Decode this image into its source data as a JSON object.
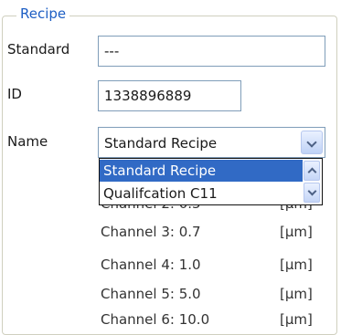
{
  "group": {
    "title": "Recipe"
  },
  "fields": {
    "standard": {
      "label": "Standard",
      "value": "---"
    },
    "id": {
      "label": "ID",
      "value": "1338896889"
    },
    "name": {
      "label": "Name",
      "value": "Standard Recipe"
    }
  },
  "dropdown": {
    "options": [
      "Standard Recipe",
      "Qualifcation C11"
    ],
    "selected_index": 0
  },
  "channels": [
    {
      "label": "Channel 2: 0.5",
      "unit": "[µm]"
    },
    {
      "label": "Channel 3: 0.7",
      "unit": "[µm]"
    },
    {
      "label": "Channel 4: 1.0",
      "unit": "[µm]"
    },
    {
      "label": "Channel 5: 5.0",
      "unit": "[µm]"
    },
    {
      "label": "Channel 6: 10.0",
      "unit": "[µm]"
    }
  ],
  "icons": {
    "select_dropdown": "chevron-down-icon",
    "scroll_up": "scroll-up-icon",
    "scroll_down": "scroll-down-icon"
  }
}
